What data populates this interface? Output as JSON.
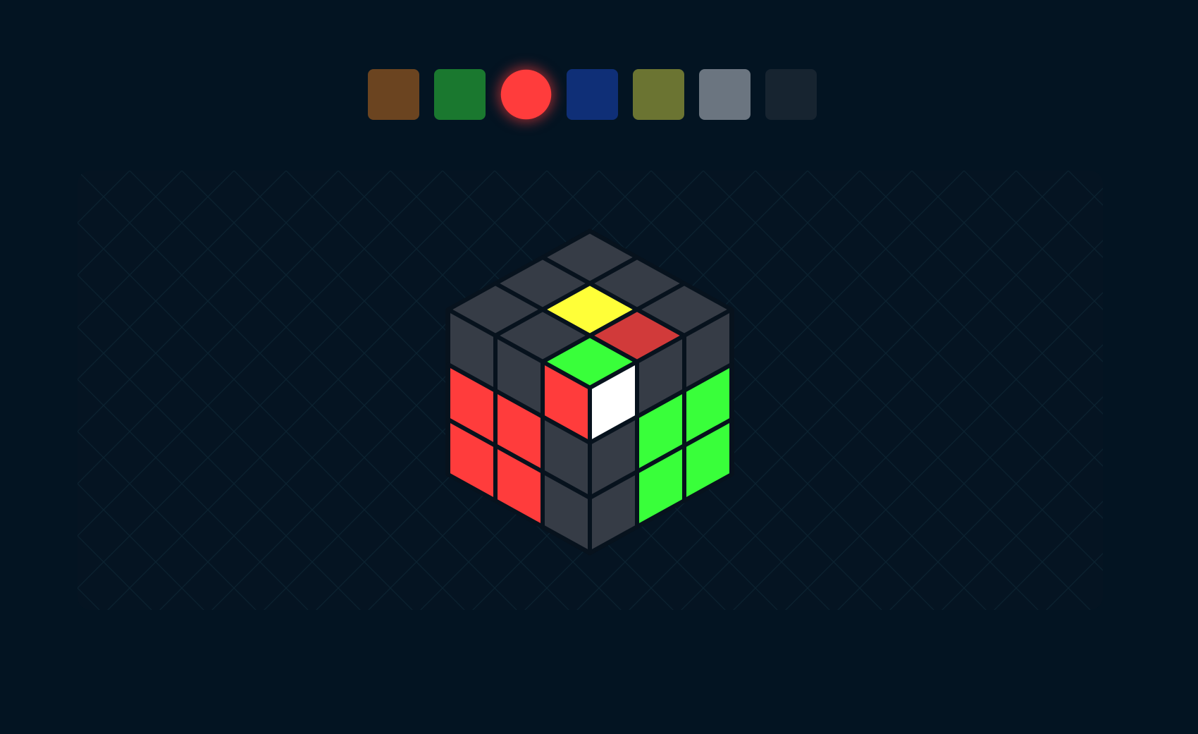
{
  "colors": {
    "page_background": "#031422",
    "stage_background": "#051422",
    "grid_line": "#0b2230",
    "cube_body": "#07121d",
    "empty_sticker": "#363c46",
    "red": "#ff3c3c",
    "green": "#39ff3a",
    "white": "#ffffff",
    "yellow": "#ffff38",
    "dark_red": "#d13a3a"
  },
  "palette": {
    "selected_index": 2,
    "swatches": [
      {
        "name": "orange",
        "color": "#6b4420"
      },
      {
        "name": "green",
        "color": "#1a782f"
      },
      {
        "name": "red",
        "color": "#ff3c3c"
      },
      {
        "name": "blue",
        "color": "#0f2f77"
      },
      {
        "name": "yellow",
        "color": "#6b7432"
      },
      {
        "name": "white",
        "color": "#6b7580"
      },
      {
        "name": "empty",
        "color": "#172430"
      }
    ]
  },
  "cube": {
    "top": [
      [
        "empty",
        "empty",
        "empty"
      ],
      [
        "empty",
        "yellow",
        "dark_red"
      ],
      [
        "empty",
        "empty",
        "empty"
      ]
    ],
    "front_left": [
      [
        "empty",
        "empty",
        "red"
      ],
      [
        "red",
        "red",
        "empty"
      ],
      [
        "red",
        "red",
        "empty"
      ]
    ],
    "front_right": [
      [
        "white",
        "empty",
        "empty"
      ],
      [
        "empty",
        "green",
        "green"
      ],
      [
        "empty",
        "green",
        "green"
      ]
    ],
    "top_front_corner_top": "green"
  }
}
